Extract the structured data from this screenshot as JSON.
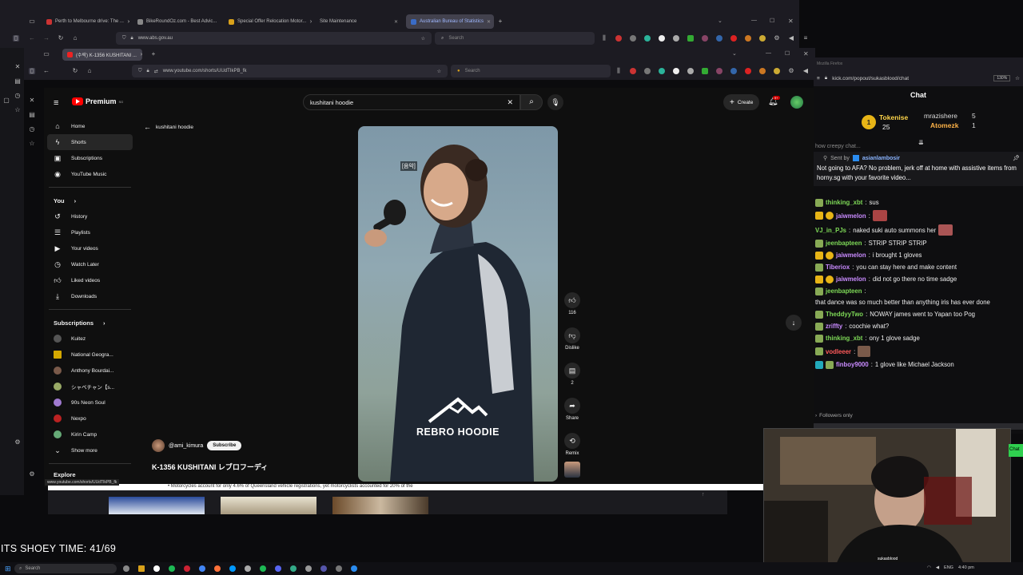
{
  "outer_browser": {
    "tabs": [
      {
        "label": "Perth to Melbourne drive: The ..."
      },
      {
        "label": "BikeRoundOz.com - Best Advic..."
      },
      {
        "label": "Special Offer Relocation Motor..."
      },
      {
        "label": "Site Maintenance"
      },
      {
        "label": "Australian Bureau of Statistics"
      }
    ],
    "url": "www.abs.gov.au",
    "search_placeholder": "Search"
  },
  "inner_browser": {
    "tab_label": "(수락) K-1356 KUSHITANI ...",
    "url": "www.youtube.com/shorts/UUdTIkPB_fk",
    "search_placeholder": "Search",
    "status_url": "www.youtube.com/shorts/UUdTIkPB_fk"
  },
  "youtube": {
    "logo": "Premium",
    "logo_badge": "SG",
    "search_value": "kushitani hoodie",
    "create_label": "Create",
    "notif_count": "9+",
    "back_label": "kushitani hoodie",
    "nav": [
      {
        "label": "Home",
        "icon": "home-icon"
      },
      {
        "label": "Shorts",
        "icon": "shorts-icon"
      },
      {
        "label": "Subscriptions",
        "icon": "subscriptions-icon"
      },
      {
        "label": "YouTube Music",
        "icon": "music-icon"
      }
    ],
    "you_label": "You",
    "you_items": [
      {
        "label": "History"
      },
      {
        "label": "Playlists"
      },
      {
        "label": "Your videos"
      },
      {
        "label": "Watch Later"
      },
      {
        "label": "Liked videos"
      },
      {
        "label": "Downloads"
      }
    ],
    "subs_label": "Subscriptions",
    "subs": [
      {
        "label": "Kuitez",
        "color": "#555"
      },
      {
        "label": "National Geogra...",
        "color": "#d4a800"
      },
      {
        "label": "Anthony Bourdai...",
        "color": "#7a5a4a"
      },
      {
        "label": "シャベチャン【s...",
        "color": "#9a6"
      },
      {
        "label": "90s Neon Soul",
        "color": "#a07ad0"
      },
      {
        "label": "Nexpo",
        "color": "#b22"
      },
      {
        "label": "Kirin Camp",
        "color": "#6a7"
      }
    ],
    "show_more": "Show more",
    "explore": "Explore",
    "video": {
      "caption_tag": "[음악]",
      "brand_text": "REBRO HOODIE",
      "channel": "@ami_kimura",
      "subscribe": "Subscribe",
      "title": "K-1356 KUSHITANI レブロフーディ"
    },
    "actions": {
      "like_count": "116",
      "dislike": "Dislike",
      "comments": "2",
      "share": "Share",
      "remix": "Remix"
    },
    "below_text": "• Motorcycles account for only 4.6% of Queensland vehicle registrations, yet motorcyclists accounted for 20% of the"
  },
  "chat": {
    "url": "kick.com/popout/sukasblood/chat",
    "zoom": "130%",
    "title": "Chat",
    "window_label": "Mozilla Firefox",
    "leaderboard": [
      {
        "rank": "1",
        "name": "Tokenise",
        "count": "25"
      },
      {
        "rank": "",
        "name": "mrazishere",
        "count": "5"
      },
      {
        "rank": "",
        "name": "Atomezk",
        "count": "1"
      }
    ],
    "partial_top": "how creepy chat...",
    "pinned_prefix": "Sent by",
    "pinned_user": "asianlambosir",
    "pinned_text": "Not going to AFA? No problem, jerk off at home with assistive items from horny.sg with your favorite video...",
    "messages": [
      {
        "user": "thinking_xbt",
        "color": "#7ed957",
        "text": "sus"
      },
      {
        "user": "jaiwmelon",
        "color": "#c98bff",
        "text": ""
      },
      {
        "user": "VJ_in_PJs",
        "color": "#7ed957",
        "text": "naked suki auto summons her"
      },
      {
        "user": "jeenbapteen",
        "color": "#7ed957",
        "text": "STRIP STRIP STRIP"
      },
      {
        "user": "jaiwmelon",
        "color": "#c98bff",
        "text": "i brought 1 gloves"
      },
      {
        "user": "Tiberiox",
        "color": "#c98bff",
        "text": "you can stay here and make content"
      },
      {
        "user": "jaiwmelon",
        "color": "#c98bff",
        "text": "did not go there no time sadge"
      },
      {
        "user": "jeenbapteen",
        "color": "#7ed957",
        "text": "that dance was so much better than anything iris has ever done"
      },
      {
        "user": "TheddyyTwo",
        "color": "#7ed957",
        "text": "NOWAY james went to Yapan too Pog"
      },
      {
        "user": "zriffty",
        "color": "#c98bff",
        "text": "coochie what?"
      },
      {
        "user": "thinking_xbt",
        "color": "#7ed957",
        "text": "ony 1 glove sadge"
      },
      {
        "user": "vodleeer",
        "color": "#ff5a5a",
        "text": ""
      },
      {
        "user": "finboy9000",
        "color": "#c98bff",
        "text": "1 glove like Michael Jackson"
      }
    ],
    "followers_only": "Followers only",
    "send_label": "Chat"
  },
  "overlay": {
    "shoey_text": "ITS SHOEY TIME: 41/69",
    "cam_handle": "sukasblood"
  },
  "taskbar": {
    "search_placeholder": "Search",
    "lang": "ENG",
    "time": "4:40 pm"
  }
}
